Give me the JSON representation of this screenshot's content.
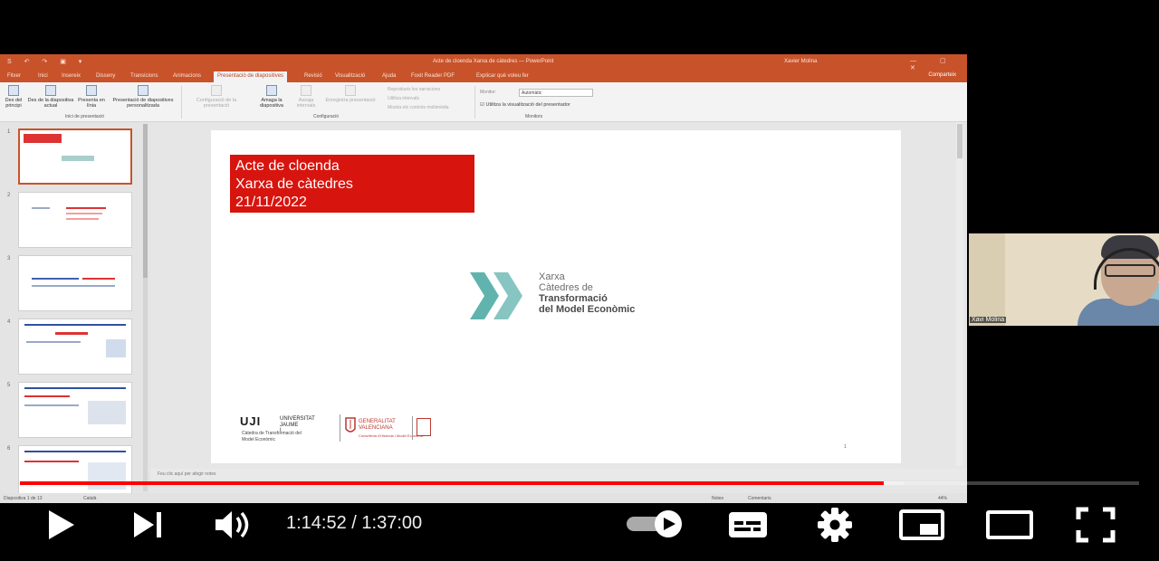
{
  "powerpoint": {
    "quick_access": "S ↶ ↷ ▣ ▾",
    "doc_title": "Acte de cloenda Xarxa de càtedres — PowerPoint",
    "user_name": "Xavier Molina",
    "window_controls": "— ▢ ✕",
    "tabs": [
      "Fitxer",
      "Inici",
      "Insereix",
      "Disseny",
      "Transicions",
      "Animacions",
      "Presentació de diapositives",
      "Revisió",
      "Visualització",
      "Ajuda",
      "Foxit Reader PDF",
      "Explicar què voleu fer"
    ],
    "active_tab_index": 6,
    "share_label": "Comparteix",
    "ribbon": {
      "from_beginning": "Des del principi",
      "from_current": "Des de la diapositiva actual",
      "present_online": "Presenta en línia",
      "custom_show": "Presentació de diapositives personalitzada",
      "group_start": "Inici de presentació",
      "setup": "Configuració de la presentació",
      "hide_slide": "Amaga la diapositiva",
      "rehearse": "Assaja intervals",
      "record": "Enregistra presentació",
      "group_setup": "Configuració",
      "play_narrations": "Reprodueix les narracions",
      "use_timings": "Utilitza intervals",
      "show_media_controls": "Mostra els controls multimèdia",
      "monitor_label": "Monitor:",
      "monitor_value": "Automàtic",
      "presenter_view": "Utilitza la visualització del presentador",
      "group_monitors": "Monitors"
    },
    "slide_numbers": [
      "1",
      "2",
      "3",
      "4",
      "5",
      "6"
    ],
    "notes_placeholder": "Feu clic aquí per afegir notes",
    "status_left": "Diapositiva 1 de 13",
    "status_lang": "Català",
    "status_notes": "Notes",
    "status_comments": "Comentaris",
    "status_zoom": "44%"
  },
  "slide": {
    "title_line1": "Acte de cloenda",
    "title_line2": "Xarxa de càtedres",
    "title_line3": "21/11/2022",
    "logo_line1": "Xarxa",
    "logo_line2": "Càtedres de",
    "logo_line3": "Transformació",
    "logo_line4": "del Model Econòmic",
    "uji_mark": "UJI",
    "uji_name1": "UNIVERSITAT",
    "uji_name2": "JAUME I",
    "uji_chair1": "Càtedra de Transformació del",
    "uji_chair2": "Model Econòmic",
    "gva_name1": "GENERALITAT",
    "gva_name2": "VALENCIANA",
    "gva_small": "Conselleria d'Hisenda i Model Econòmic",
    "page_num": "1"
  },
  "webcam": {
    "name": "Xavi Molina"
  },
  "player": {
    "current_time": "1:14:52",
    "duration": "1:37:00",
    "time_text": "1:14:52 / 1:37:00",
    "played_fraction": 0.772,
    "loaded_fraction": 0.79,
    "autoplay": true
  },
  "colors": {
    "ppt_accent": "#c8532a",
    "slide_red": "#d7140e",
    "xarxa_teal": "#45a6a0",
    "progress_red": "#ff0000"
  }
}
